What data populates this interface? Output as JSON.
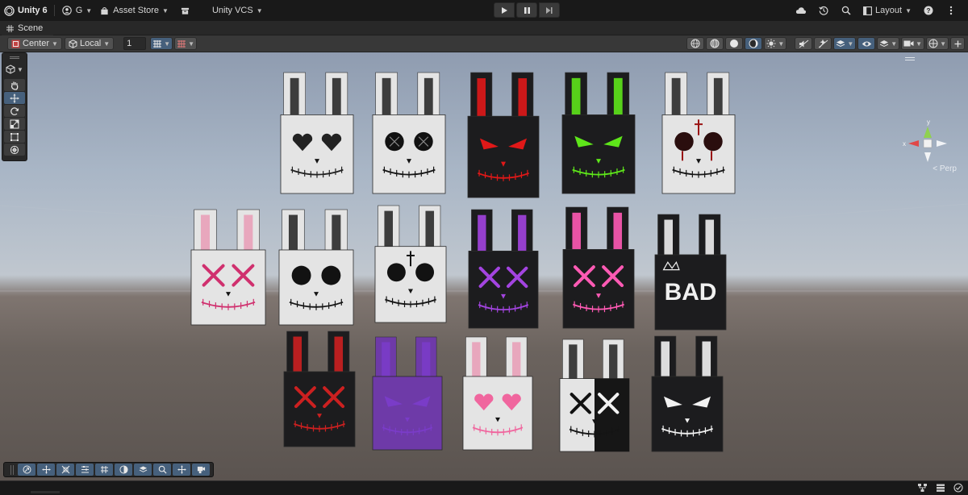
{
  "topbar": {
    "app_title": "Unity 6",
    "account_label": "G",
    "asset_store_label": "Asset Store",
    "vcs_label": "Unity VCS",
    "layout_label": "Layout"
  },
  "play_controls": {
    "play_icon": "play-icon",
    "pause_icon": "pause-icon",
    "step_icon": "step-icon"
  },
  "scene_tab": {
    "label": "Scene"
  },
  "scene_toolbar": {
    "pivot_mode_label": "Center",
    "pivot_rotation_label": "Local",
    "grid_snap_value": "1"
  },
  "gizmo": {
    "persp_label": "Perp",
    "y_axis_label": "y",
    "x_axis_label": "x"
  },
  "colors": {
    "accent_active": "#46607c",
    "toolbar_bg": "#383838",
    "topbar_bg": "#191919",
    "sky": "#a9b6c6",
    "ground": "#6b635e"
  },
  "scene_objects": [
    {
      "row": 1,
      "style": "white-cracked-heart-eyes",
      "accent": "#222222"
    },
    {
      "row": 1,
      "style": "white-stitched-button-eyes",
      "accent": "#2a2a2a"
    },
    {
      "row": 1,
      "style": "black-red-evil-grin",
      "accent": "#e01818"
    },
    {
      "row": 1,
      "style": "black-green-evil-grin",
      "accent": "#5ee61a"
    },
    {
      "row": 1,
      "style": "white-bloody-skull-cross",
      "accent": "#9a1414"
    },
    {
      "row": 2,
      "style": "white-pink-x-eyes",
      "accent": "#d0306e"
    },
    {
      "row": 2,
      "style": "white-cracked-skull",
      "accent": "#222222"
    },
    {
      "row": 2,
      "style": "white-cross-skull",
      "accent": "#222222"
    },
    {
      "row": 2,
      "style": "black-purple-x-grin",
      "accent": "#a344e0"
    },
    {
      "row": 2,
      "style": "black-pink-x-grin",
      "accent": "#ff5ab4"
    },
    {
      "row": 2,
      "style": "black-bad-crown",
      "accent": "#eeeeee"
    },
    {
      "row": 3,
      "style": "black-red-x-eyes",
      "accent": "#cc2020"
    },
    {
      "row": 3,
      "style": "purple-white-evil-flames",
      "accent": "#7a3cc8"
    },
    {
      "row": 3,
      "style": "white-pink-heart-eyes",
      "accent": "#f0669e"
    },
    {
      "row": 3,
      "style": "split-black-white-x-heart",
      "accent": "#1a1a1a"
    },
    {
      "row": 3,
      "style": "black-white-drip-evil",
      "accent": "#f2f2f2"
    }
  ]
}
